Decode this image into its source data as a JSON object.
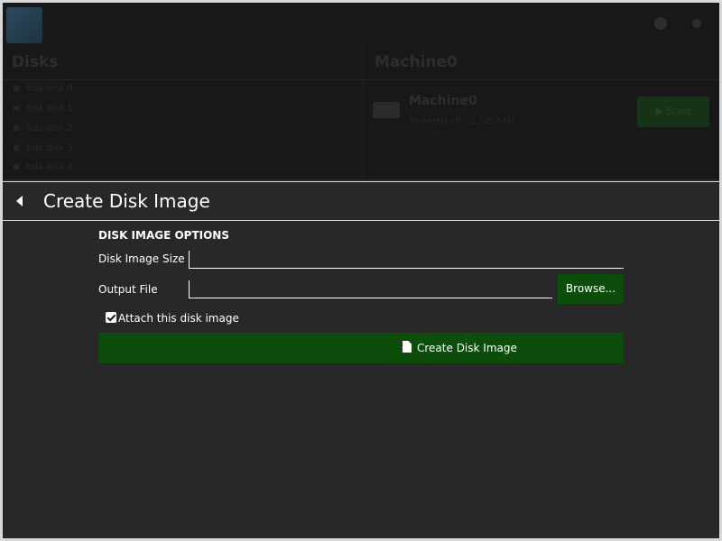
{
  "background": {
    "sidebar_heading": "Disks",
    "sidebar_items": [
      "hda disk 0",
      "hda disk 1",
      "hda disk 2",
      "hda disk 3",
      "hda disk 4"
    ],
    "main_heading": "Machine0",
    "vm_name": "Machine0",
    "vm_sub": "Powered off · 2 GB RAM",
    "start_label": "▶ Start"
  },
  "panel": {
    "title": "Create Disk Image"
  },
  "form": {
    "section_title": "DISK IMAGE OPTIONS",
    "size_label": "Disk Image Size",
    "size_value": "",
    "output_label": "Output File",
    "output_value": "",
    "browse_label": "Browse...",
    "attach_label": "Attach this disk image",
    "attach_checked": true,
    "create_label": "Create Disk Image"
  },
  "colors": {
    "background": "#282828",
    "accent_green": "#0c4d0c",
    "text": "#ffffff"
  },
  "icons": {
    "back": "back-arrow-icon",
    "create": "file-icon",
    "check": "checkmark-icon"
  }
}
